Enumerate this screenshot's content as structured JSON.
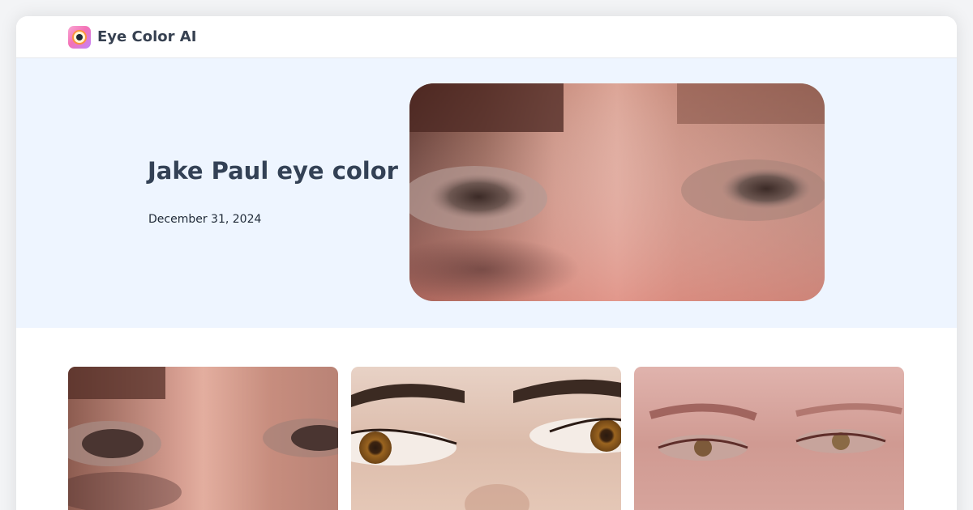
{
  "header": {
    "logo_icon": "eye-logo-icon",
    "app_name": "Eye Color AI"
  },
  "hero": {
    "title": "Jake Paul eye color",
    "date": "December 31, 2024"
  },
  "thumbnails": [
    {
      "icon": "eye-photo"
    },
    {
      "icon": "eye-photo"
    },
    {
      "icon": "eye-photo"
    }
  ]
}
